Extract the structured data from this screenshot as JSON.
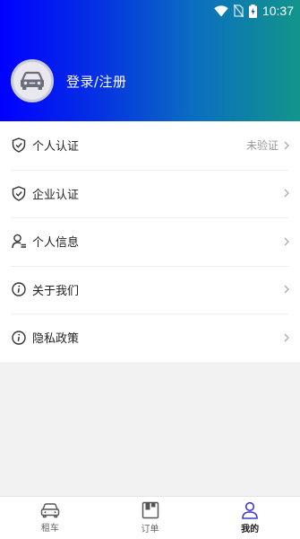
{
  "status_bar": {
    "time": "10:37"
  },
  "header": {
    "login_label": "登录/注册"
  },
  "menu": {
    "items": [
      {
        "label": "个人认证",
        "status": "未验证",
        "icon": "shield-check-icon"
      },
      {
        "label": "企业认证",
        "status": "",
        "icon": "shield-check-icon"
      },
      {
        "label": "个人信息",
        "status": "",
        "icon": "user-info-icon"
      },
      {
        "label": "关于我们",
        "status": "",
        "icon": "info-circle-icon"
      },
      {
        "label": "隐私政策",
        "status": "",
        "icon": "info-circle-icon"
      }
    ]
  },
  "tabbar": {
    "tabs": [
      {
        "label": "租车",
        "icon": "car-icon"
      },
      {
        "label": "订单",
        "icon": "order-icon"
      },
      {
        "label": "我的",
        "icon": "person-icon",
        "active": true
      }
    ]
  },
  "colors": {
    "header_gradient_start": "#0000ff",
    "header_gradient_end": "#12958a",
    "active_tab": "#3a3acc"
  }
}
